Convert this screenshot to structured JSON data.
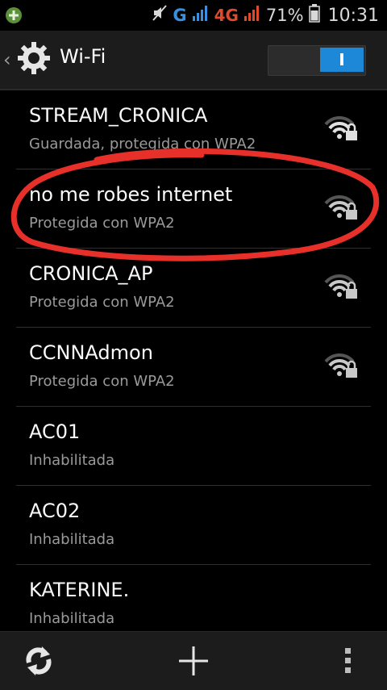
{
  "status_bar": {
    "network_g": "G",
    "network_4g": "4G",
    "battery": "71%",
    "time": "10:31",
    "left_icon": "add-circle-icon",
    "right_icons": [
      "mute-icon",
      "signal-icon",
      "signal-icon",
      "battery-icon"
    ]
  },
  "action_bar": {
    "title": "Wi-Fi",
    "back_icon": "chevron-left-icon",
    "settings_icon": "gear-icon",
    "switch_label": "I",
    "switch_on": true
  },
  "networks": [
    {
      "name": "STREAM_CRONICA",
      "status": "Guardada, protegida con WPA2",
      "secured": true,
      "signal_color": "#e0e0e0"
    },
    {
      "name": "no me robes internet",
      "status": "Protegida con WPA2",
      "secured": true,
      "signal_color": "#c8c8c8"
    },
    {
      "name": "CRONICA_AP",
      "status": "Protegida con WPA2",
      "secured": true,
      "signal_color": "#c8c8c8"
    },
    {
      "name": "CCNNAdmon",
      "status": "Protegida con WPA2",
      "secured": true,
      "signal_color": "#c8c8c8"
    },
    {
      "name": "AC01",
      "status": "Inhabilitada",
      "secured": false
    },
    {
      "name": "AC02",
      "status": "Inhabilitada",
      "secured": false
    },
    {
      "name": "KATERINE.",
      "status": "Inhabilitada",
      "secured": false
    }
  ],
  "bottom_bar": {
    "icons": [
      "refresh-icon",
      "add-icon",
      "overflow-menu-icon"
    ]
  },
  "colors": {
    "accent": "#1e88d8",
    "annotation": "#e8302a",
    "background": "#000000"
  }
}
